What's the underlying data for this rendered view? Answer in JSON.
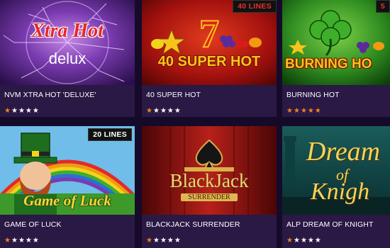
{
  "games": [
    {
      "title": "NVM XTRA HOT 'DELUXE'",
      "logo": "Xtra Hot",
      "logo_sub": "delux",
      "rating": 1,
      "badge": ""
    },
    {
      "title": "40 SUPER HOT",
      "logo": "40 SUPER HOT",
      "rating": 1,
      "badge": "40 LINES"
    },
    {
      "title": "BURNING HOT",
      "logo": "BURNING HO",
      "rating": 5,
      "badge": "5"
    },
    {
      "title": "GAME OF LUCK",
      "logo": "Game of Luck",
      "rating": 1,
      "badge": "20 LINES"
    },
    {
      "title": "BLACKJACK SURRENDER",
      "logo": "BlackJack",
      "logo_sub": "SURRENDER",
      "rating": 1,
      "badge": ""
    },
    {
      "title": "ALP DREAM OF KNIGHT",
      "logo": "Dream",
      "logo_mid": "of",
      "logo_sub": "Knigh",
      "rating": 1,
      "badge": ""
    }
  ],
  "colors": {
    "star_active": "#f0831c",
    "star_inactive": "#ffffff",
    "caption_bg": "#2a1845",
    "page_bg": "#160a2a"
  }
}
